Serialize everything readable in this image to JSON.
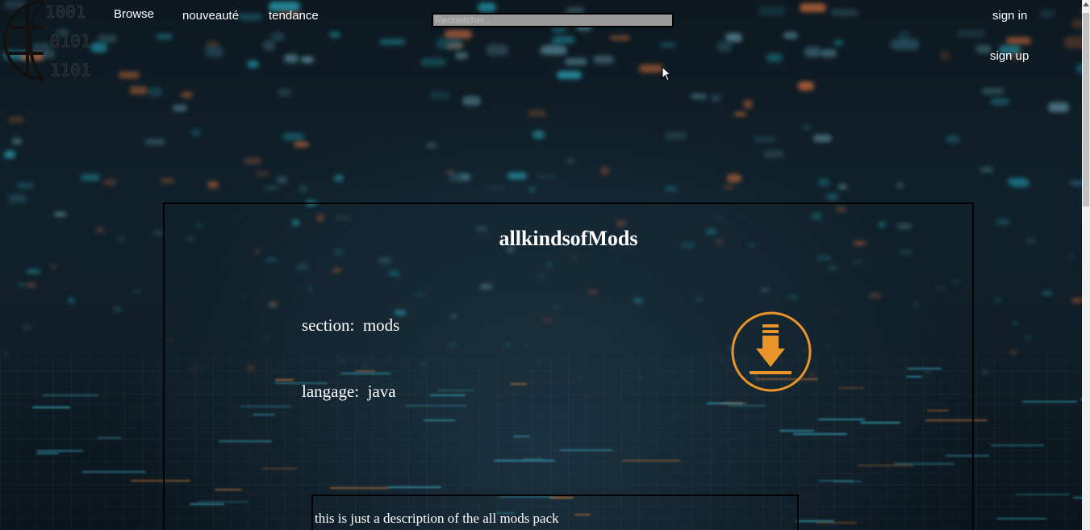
{
  "header": {
    "logo_text": [
      "1001",
      "0101",
      "1101"
    ],
    "nav": {
      "browse": "Browse",
      "new": "nouveauté",
      "trending": "tendance"
    },
    "search": {
      "placeholder": "Rechercher..",
      "value": ""
    },
    "auth": {
      "sign_in": "sign in",
      "sign_up": "sign up"
    }
  },
  "card": {
    "title": "allkindsofMods",
    "section_label": "section:",
    "section_value": "mods",
    "language_label": "langage:",
    "language_value": "java",
    "download_icon": "download-icon",
    "description": "this is just a description of the all mods pack"
  },
  "colors": {
    "accent": "#e8952a",
    "background": "#0f1d26",
    "text": "#ffffff",
    "border": "#000000"
  }
}
